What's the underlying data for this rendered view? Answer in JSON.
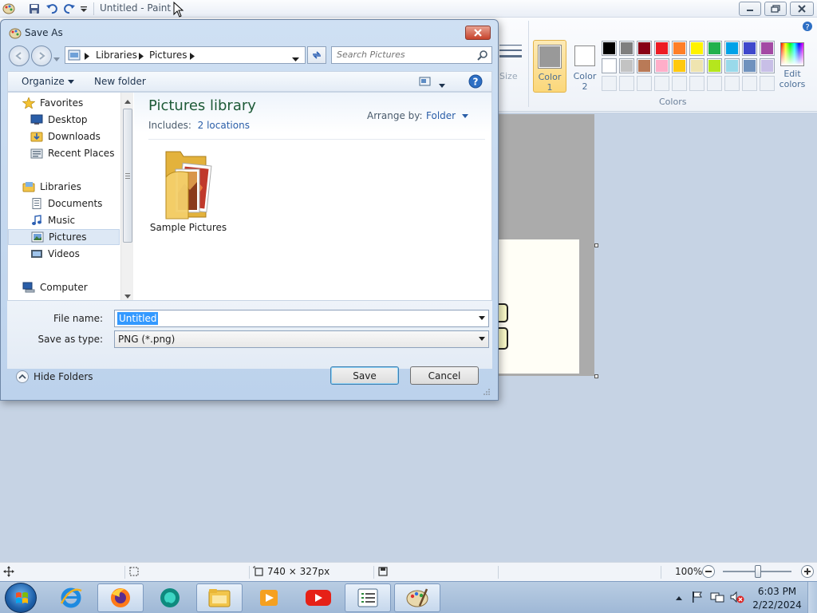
{
  "paint": {
    "title": "Untitled - Paint",
    "ribbon": {
      "size_label": "Size",
      "color1_label": "Color\n1",
      "color1_line1": "Color",
      "color1_line2": "1",
      "color2_line1": "Color",
      "color2_line2": "2",
      "edit_colors_line1": "Edit",
      "edit_colors_line2": "colors",
      "colors_group_label": "Colors",
      "color1_value": "#999999",
      "color2_value": "#ffffff",
      "palette_row1": [
        "#000000",
        "#7f7f7f",
        "#880015",
        "#ed1c24",
        "#ff7f27",
        "#fff200",
        "#22b14c",
        "#00a2e8",
        "#3f48cc",
        "#a349a4"
      ],
      "palette_row2": [
        "#ffffff",
        "#c3c3c3",
        "#b97a57",
        "#ffaec9",
        "#ffc90e",
        "#efe4b0",
        "#b5e61d",
        "#99d9ea",
        "#7092be",
        "#c8bfe7"
      ]
    },
    "status": {
      "canvas_size": "740 × 327px",
      "zoom": "100%"
    }
  },
  "dialog": {
    "title": "Save As",
    "breadcrumb": [
      "Libraries",
      "Pictures"
    ],
    "search_placeholder": "Search Pictures",
    "organize_label": "Organize",
    "new_folder_label": "New folder",
    "nav": {
      "favorites": "Favorites",
      "desktop": "Desktop",
      "downloads": "Downloads",
      "recent": "Recent Places",
      "libraries": "Libraries",
      "documents": "Documents",
      "music": "Music",
      "pictures": "Pictures",
      "videos": "Videos",
      "computer": "Computer"
    },
    "library_title": "Pictures library",
    "includes_label": "Includes:",
    "includes_link": "2 locations",
    "arrange_label": "Arrange by:",
    "arrange_value": "Folder",
    "folder_item": "Sample Pictures",
    "file_name_label": "File name:",
    "file_name_value": "Untitled",
    "save_type_label": "Save as type:",
    "save_type_value": "PNG (*.png)",
    "hide_folders_label": "Hide Folders",
    "save_label": "Save",
    "cancel_label": "Cancel"
  },
  "taskbar": {
    "time": "6:03 PM",
    "date": "2/22/2024"
  }
}
